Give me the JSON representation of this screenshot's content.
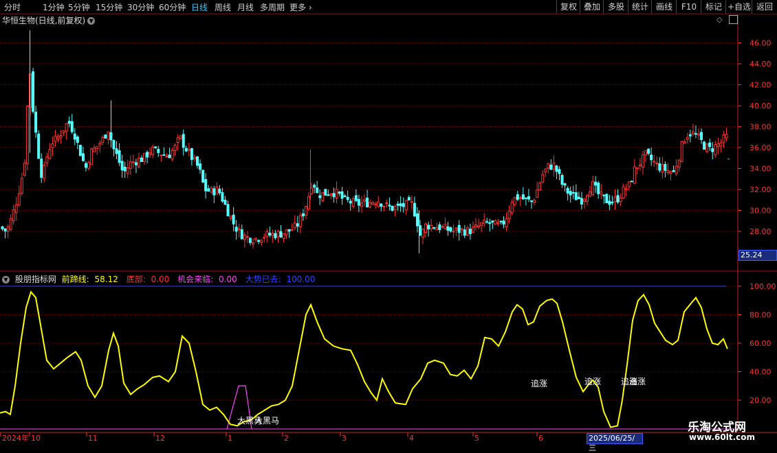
{
  "toolbar": {
    "periods": [
      "分时",
      "1分钟",
      "5分钟",
      "15分钟",
      "30分钟",
      "60分钟",
      "日线",
      "周线",
      "月线",
      "多周期",
      "更多"
    ],
    "active_period": "日线",
    "right_buttons": [
      "复权",
      "叠加",
      "多股",
      "统计",
      "画线",
      "F10",
      "标记",
      "+自选",
      "返回"
    ]
  },
  "stock": {
    "title": "华恒生物(日线,前复权)"
  },
  "price_axis": {
    "ticks": [
      "46.00",
      "44.00",
      "42.00",
      "40.00",
      "38.00",
      "36.00",
      "34.00",
      "32.00",
      "30.00",
      "28.00"
    ],
    "current_price": "25.24"
  },
  "indicator": {
    "name": "股朋指标网",
    "items": [
      {
        "label": "前蹄线:",
        "value": "58.12",
        "color": "#ffff00"
      },
      {
        "label": "底部:",
        "value": "0.00",
        "color": "#ff3333"
      },
      {
        "label": "机会来临:",
        "value": "0.00",
        "color": "#ff44ff"
      },
      {
        "label": "大势已去:",
        "value": "100.00",
        "color": "#3344ff"
      }
    ],
    "axis_ticks": [
      "100.00",
      "80.00",
      "60.00",
      "40.00",
      "20.00"
    ],
    "annotations": [
      "大黑马",
      "追涨",
      "追涨",
      "追涨"
    ]
  },
  "time_axis": {
    "labels": [
      "2024年",
      "10",
      "11",
      "12",
      "1",
      "2",
      "3",
      "4",
      "5",
      "6"
    ],
    "cursor_date": "2025/06/25/三"
  },
  "watermark": {
    "title": "乐淘公式网",
    "url": "www.60lt.com"
  },
  "colors": {
    "up": "#ff3333",
    "down": "#54ffff",
    "line": "#ffff00",
    "grid": "#8b0000",
    "axis": "#ff3333"
  }
}
